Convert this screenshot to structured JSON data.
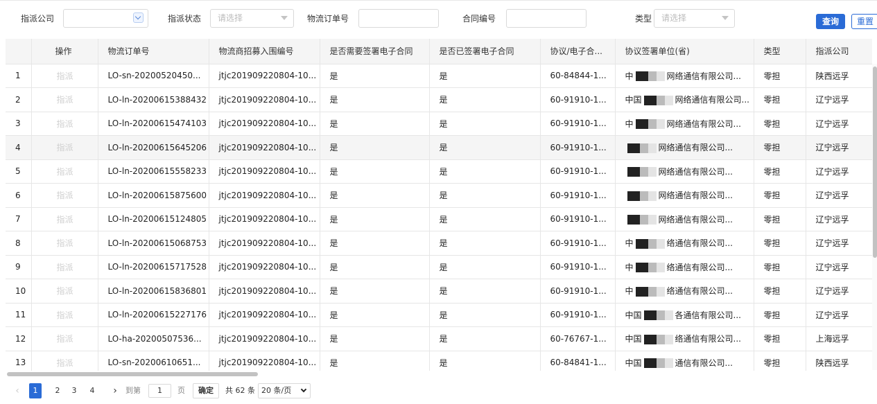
{
  "filters": {
    "company_label": "指派公司",
    "company_value": "",
    "status_label": "指派状态",
    "status_placeholder": "请选择",
    "order_label": "物流订单号",
    "order_value": "",
    "contract_label": "合同编号",
    "contract_value": "",
    "type_label": "类型",
    "type_placeholder": "请选择",
    "query_button": "查询",
    "reset_button": "重置"
  },
  "table": {
    "columns": [
      "",
      "操作",
      "物流订单号",
      "物流商招募入围编号",
      "是否需要签署电子合同",
      "是否已签署电子合同",
      "协议/电子合...",
      "协议签署单位(省)",
      "类型",
      "指派公司"
    ],
    "highlighted_row": 4,
    "rows": [
      {
        "idx": "1",
        "op": "指派",
        "order": "LO-sn-20200520450...",
        "recruit": "jtjc201909220804-10...",
        "need": "是",
        "signed": "是",
        "contract": "60-84844-1...",
        "unit_pre": "中",
        "unit_post": "网络通信有限公司...",
        "type": "零担",
        "company": "陕西远孚"
      },
      {
        "idx": "2",
        "op": "指派",
        "order": "LO-ln-20200615388432",
        "recruit": "jtjc201909220804-10...",
        "need": "是",
        "signed": "是",
        "contract": "60-91910-1...",
        "unit_pre": "中国",
        "unit_post": "网络通信有限公司...",
        "type": "零担",
        "company": "辽宁远孚"
      },
      {
        "idx": "3",
        "op": "指派",
        "order": "LO-ln-20200615474103",
        "recruit": "jtjc201909220804-10...",
        "need": "是",
        "signed": "是",
        "contract": "60-91910-1...",
        "unit_pre": "中",
        "unit_post": "网络通信有限公司...",
        "type": "零担",
        "company": "辽宁远孚"
      },
      {
        "idx": "4",
        "op": "指派",
        "order": "LO-ln-20200615645206",
        "recruit": "jtjc201909220804-10...",
        "need": "是",
        "signed": "是",
        "contract": "60-91910-1...",
        "unit_pre": "",
        "unit_post": "网络通信有限公司...",
        "type": "零担",
        "company": "辽宁远孚"
      },
      {
        "idx": "5",
        "op": "指派",
        "order": "LO-ln-20200615558233",
        "recruit": "jtjc201909220804-10...",
        "need": "是",
        "signed": "是",
        "contract": "60-91910-1...",
        "unit_pre": "",
        "unit_post": "网络通信有限公司...",
        "type": "零担",
        "company": "辽宁远孚"
      },
      {
        "idx": "6",
        "op": "指派",
        "order": "LO-ln-20200615875600",
        "recruit": "jtjc201909220804-10...",
        "need": "是",
        "signed": "是",
        "contract": "60-91910-1...",
        "unit_pre": "",
        "unit_post": "网络通信有限公司...",
        "type": "零担",
        "company": "辽宁远孚"
      },
      {
        "idx": "7",
        "op": "指派",
        "order": "LO-ln-20200615124805",
        "recruit": "jtjc201909220804-10...",
        "need": "是",
        "signed": "是",
        "contract": "60-91910-1...",
        "unit_pre": "",
        "unit_post": "网络通信有限公司...",
        "type": "零担",
        "company": "辽宁远孚"
      },
      {
        "idx": "8",
        "op": "指派",
        "order": "LO-ln-20200615068753",
        "recruit": "jtjc201909220804-10...",
        "need": "是",
        "signed": "是",
        "contract": "60-91910-1...",
        "unit_pre": "中",
        "unit_post": "络通信有限公司...",
        "type": "零担",
        "company": "辽宁远孚"
      },
      {
        "idx": "9",
        "op": "指派",
        "order": "LO-ln-20200615717528",
        "recruit": "jtjc201909220804-10...",
        "need": "是",
        "signed": "是",
        "contract": "60-91910-1...",
        "unit_pre": "中",
        "unit_post": "络通信有限公司...",
        "type": "零担",
        "company": "辽宁远孚"
      },
      {
        "idx": "10",
        "op": "指派",
        "order": "LO-ln-20200615836801",
        "recruit": "jtjc201909220804-10...",
        "need": "是",
        "signed": "是",
        "contract": "60-91910-1...",
        "unit_pre": "中",
        "unit_post": "络通信有限公司...",
        "type": "零担",
        "company": "辽宁远孚"
      },
      {
        "idx": "11",
        "op": "指派",
        "order": "LO-ln-20200615227176",
        "recruit": "jtjc201909220804-10...",
        "need": "是",
        "signed": "是",
        "contract": "60-91910-1...",
        "unit_pre": "中国",
        "unit_post": "各通信有限公司...",
        "type": "零担",
        "company": "辽宁远孚"
      },
      {
        "idx": "12",
        "op": "指派",
        "order": "LO-ha-20200507536...",
        "recruit": "jtjc201909220804-10...",
        "need": "是",
        "signed": "是",
        "contract": "60-76767-1...",
        "unit_pre": "中国",
        "unit_post": "络通信有限公司...",
        "type": "零担",
        "company": "上海远孚"
      },
      {
        "idx": "13",
        "op": "指派",
        "order": "LO-sn-20200610651...",
        "recruit": "jtjc201909220804-10...",
        "need": "是",
        "signed": "是",
        "contract": "60-84841-1...",
        "unit_pre": "中国",
        "unit_post": "通信有限公司...",
        "type": "零担",
        "company": "陕西远孚"
      }
    ]
  },
  "pager": {
    "pages": [
      "1",
      "2",
      "3",
      "4"
    ],
    "active_page": "1",
    "goto_label": "到第",
    "goto_value": "1",
    "page_unit": "页",
    "confirm": "确定",
    "total": "共 62 条",
    "page_size": "20 条/页"
  },
  "colors": {
    "primary": "#2a6bd6",
    "header_bg": "#f5f5f5",
    "disabled_text": "#cfcfcf"
  }
}
